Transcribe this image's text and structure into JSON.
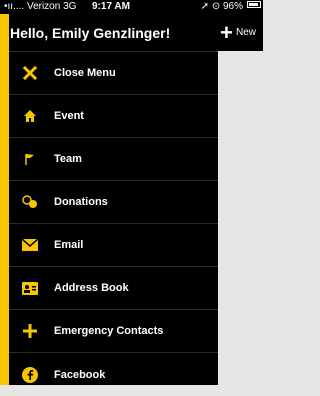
{
  "status": {
    "carrier": "Verizon",
    "network": "3G",
    "time": "9:17 AM",
    "battery": "96%"
  },
  "header": {
    "greeting": "Hello, Emily Genzlinger!"
  },
  "right_panel": {
    "new_label": "New"
  },
  "menu": {
    "items": [
      {
        "label": "Close Menu",
        "icon": "close-icon"
      },
      {
        "label": "Event",
        "icon": "home-icon"
      },
      {
        "label": "Team",
        "icon": "flag-icon"
      },
      {
        "label": "Donations",
        "icon": "coins-icon"
      },
      {
        "label": "Email",
        "icon": "envelope-icon"
      },
      {
        "label": "Address Book",
        "icon": "address-book-icon"
      },
      {
        "label": "Emergency Contacts",
        "icon": "plus-icon"
      },
      {
        "label": "Facebook",
        "icon": "facebook-icon"
      }
    ]
  },
  "colors": {
    "accent": "#f7c600",
    "menu_bg": "#000000",
    "content_bg": "#e6e6e6"
  }
}
